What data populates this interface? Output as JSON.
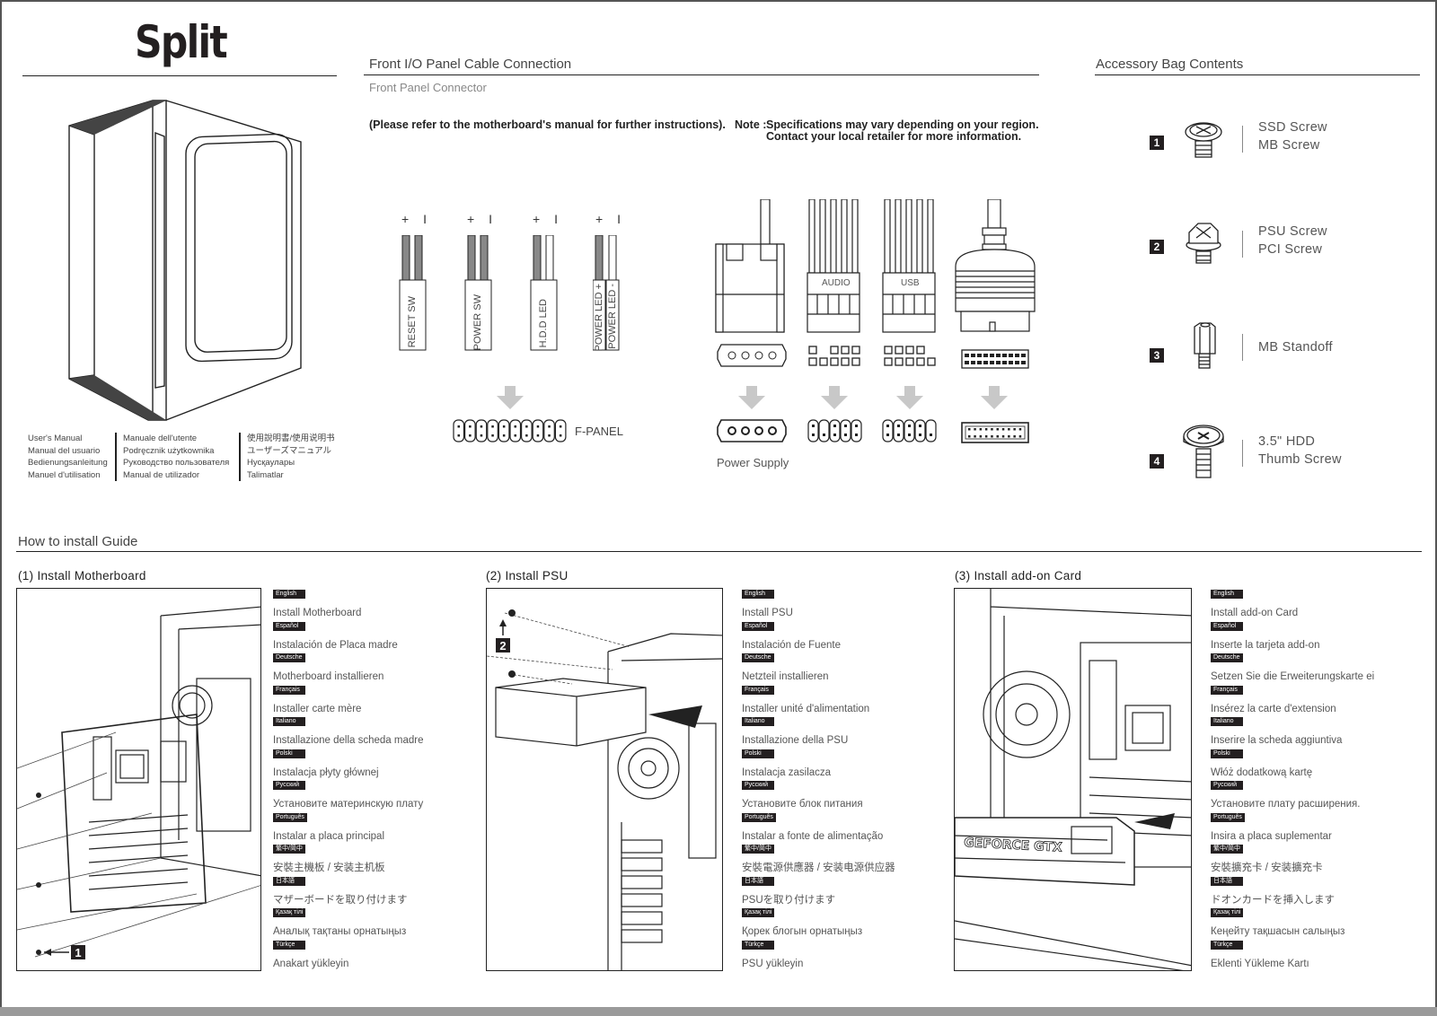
{
  "brand": {
    "name": "Split"
  },
  "manual_titles": {
    "col1": [
      "User's Manual",
      "Manual del usuario",
      "Bedienungsanleitung",
      "Manuel d'utilisation"
    ],
    "col2": [
      "Manuale dell'utente",
      "Podręcznik użytkownika",
      "Руководство пользователя",
      "Manual de utilizador"
    ],
    "col3": [
      "使用說明書/使用说明书",
      "ユーザーズマニュアル",
      "Нусқаулары",
      "Talimatlar"
    ]
  },
  "front_io": {
    "title": "Front I/O Panel Cable Connection",
    "subtitle": "Front Panel Connector",
    "instruction": "(Please refer to the motherboard's manual for further instructions).",
    "note_prefix": "Note :",
    "note_line1": "Specifications may vary depending on your region.",
    "note_line2": "Contact your local retailer for more information.",
    "polarity": "+ I",
    "connectors": [
      {
        "label": "RESET SW"
      },
      {
        "label": "POWER SW"
      },
      {
        "label": "H.D.D LED"
      },
      {
        "label": "POWER LED +",
        "label2": "POWER LED -"
      }
    ],
    "fpanel_label": "F-PANEL",
    "cable_labels": {
      "audio": "AUDIO",
      "usb": "USB"
    },
    "power_supply_label": "Power Supply"
  },
  "accessory": {
    "title": "Accessory Bag Contents",
    "items": [
      {
        "num": "1",
        "icon": "pan-head-screw-icon",
        "lines": [
          "SSD Screw",
          "MB Screw"
        ]
      },
      {
        "num": "2",
        "icon": "hex-screw-icon",
        "lines": [
          "PSU Screw",
          "PCI Screw"
        ]
      },
      {
        "num": "3",
        "icon": "standoff-icon",
        "lines": [
          "MB Standoff"
        ]
      },
      {
        "num": "4",
        "icon": "thumb-screw-icon",
        "lines": [
          "3.5\" HDD",
          "Thumb Screw"
        ]
      }
    ]
  },
  "guide": {
    "title": "How to install Guide",
    "steps": [
      {
        "title": "(1) Install Motherboard",
        "callout": "1",
        "langs": [
          {
            "tag": "English",
            "text": "Install Motherboard"
          },
          {
            "tag": "Español",
            "text": "Instalación de Placa madre"
          },
          {
            "tag": "Deutsche",
            "text": "Motherboard installieren"
          },
          {
            "tag": "Français",
            "text": "Installer carte mère"
          },
          {
            "tag": "Italiano",
            "text": "Installazione della scheda madre"
          },
          {
            "tag": "Polski",
            "text": "Instalacja płyty głównej"
          },
          {
            "tag": "Русский",
            "text": "Установите материнскую плату"
          },
          {
            "tag": "Português",
            "text": "Instalar a placa principal"
          },
          {
            "tag": "繁中/简中",
            "text": "安裝主機板 / 安装主机板"
          },
          {
            "tag": "日本語",
            "text": "マザーボードを取り付けます"
          },
          {
            "tag": "Қазақ тілі",
            "text": "Аналық тақтаны орнатыңыз"
          },
          {
            "tag": "Türkçe",
            "text": "Anakart yükleyin"
          }
        ]
      },
      {
        "title": "(2) Install PSU",
        "callout": "2",
        "langs": [
          {
            "tag": "English",
            "text": "Install PSU"
          },
          {
            "tag": "Español",
            "text": "Instalación de Fuente"
          },
          {
            "tag": "Deutsche",
            "text": "Netzteil installieren"
          },
          {
            "tag": "Français",
            "text": "Installer unité d'alimentation"
          },
          {
            "tag": "Italiano",
            "text": "Installazione della PSU"
          },
          {
            "tag": "Polski",
            "text": "Instalacja zasilacza"
          },
          {
            "tag": "Русский",
            "text": "Установите блок питания"
          },
          {
            "tag": "Português",
            "text": "Instalar a fonte de alimentação"
          },
          {
            "tag": "繁中/简中",
            "text": "安裝電源供應器 / 安装电源供应器"
          },
          {
            "tag": "日本語",
            "text": "PSUを取り付けます"
          },
          {
            "tag": "Қазақ тілі",
            "text": "Қорек блогын орнатыңыз"
          },
          {
            "tag": "Türkçe",
            "text": "PSU yükleyin"
          }
        ]
      },
      {
        "title": "(3) Install add-on Card",
        "card_label": "GEFORCE GTX",
        "langs": [
          {
            "tag": "English",
            "text": "Install add-on Card"
          },
          {
            "tag": "Español",
            "text": "Inserte la tarjeta add-on"
          },
          {
            "tag": "Deutsche",
            "text": "Setzen Sie die Erweiterungskarte ei"
          },
          {
            "tag": "Français",
            "text": "Insérez la carte d'extension"
          },
          {
            "tag": "Italiano",
            "text": "Inserire la scheda aggiuntiva"
          },
          {
            "tag": "Polski",
            "text": "Włóż dodatkową kartę"
          },
          {
            "tag": "Русский",
            "text": "Установите плату расширения."
          },
          {
            "tag": "Português",
            "text": "Insira a placa suplementar"
          },
          {
            "tag": "繁中/简中",
            "text": "安裝擴充卡 / 安装擴充卡"
          },
          {
            "tag": "日本語",
            "text": "ドオンカードを挿入します"
          },
          {
            "tag": "Қазақ тілі",
            "text": "Кеңейту тақшасын салыңыз"
          },
          {
            "tag": "Türkçe",
            "text": "Eklenti Yükleme Kartı"
          }
        ]
      }
    ]
  }
}
